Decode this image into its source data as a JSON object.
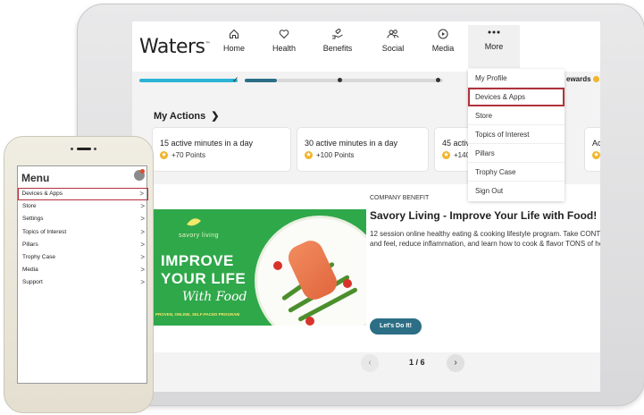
{
  "app": {
    "logo_text": "Waters",
    "logo_mark": "™"
  },
  "nav": [
    {
      "label": "Home",
      "icon": "home-icon"
    },
    {
      "label": "Health",
      "icon": "heart-icon"
    },
    {
      "label": "Benefits",
      "icon": "benefits-hand-icon"
    },
    {
      "label": "Social",
      "icon": "social-people-icon"
    },
    {
      "label": "Media",
      "icon": "play-icon"
    },
    {
      "label": "More",
      "icon": "more-dots-icon"
    }
  ],
  "rewards_label": "ewards",
  "my_actions": {
    "title": "My Actions",
    "chevron": "❯"
  },
  "actions": [
    {
      "title": "15 active minutes in a day",
      "points": "+70 Points"
    },
    {
      "title": "30 active minutes in a day",
      "points": "+100 Points"
    },
    {
      "title": "45 activ",
      "points": "+140"
    },
    {
      "title": "Ac",
      "points": ""
    }
  ],
  "feature": {
    "eyebrow": "COMPANY BENEFIT",
    "title": "Savory Living - Improve Your Life with Food!",
    "description_line1": "12 session online healthy eating & cooking lifestyle program. Take CONTRO",
    "description_line2": "and feel, reduce inflammation, and learn how to cook & flavor TONS of he",
    "cta": "Let's Do It!",
    "promo": {
      "brand": "savory living",
      "line1": "IMPROVE",
      "line2": "YOUR LIFE",
      "line3": "With Food",
      "tagline": "PROVEN, ONLINE, SELF-PACED PROGRAM"
    }
  },
  "pager": {
    "text": "1 / 6",
    "prev": "‹",
    "next": "›"
  },
  "more_menu": [
    {
      "label": "My Profile",
      "highlighted": false
    },
    {
      "label": "Devices & Apps",
      "highlighted": true
    },
    {
      "label": "Store",
      "highlighted": false
    },
    {
      "label": "Topics of Interest",
      "highlighted": false
    },
    {
      "label": "Pillars",
      "highlighted": false
    },
    {
      "label": "Trophy Case",
      "highlighted": false
    },
    {
      "label": "Sign Out",
      "highlighted": false
    }
  ],
  "phone": {
    "title": "Menu",
    "items": [
      {
        "label": "Devices & Apps",
        "highlighted": true
      },
      {
        "label": "Store",
        "highlighted": false
      },
      {
        "label": "Settings",
        "highlighted": false
      },
      {
        "label": "Topics of Interest",
        "highlighted": false
      },
      {
        "label": "Pillars",
        "highlighted": false
      },
      {
        "label": "Trophy Case",
        "highlighted": false
      },
      {
        "label": "Media",
        "highlighted": false
      },
      {
        "label": "Support",
        "highlighted": false
      }
    ],
    "chevron": ">"
  },
  "colors": {
    "accent_teal": "#2c6e86",
    "progress_cyan": "#2bb3d6",
    "highlight_red": "#b0323d",
    "promo_green": "#2fa84a",
    "points_star": "#f0b52a"
  }
}
